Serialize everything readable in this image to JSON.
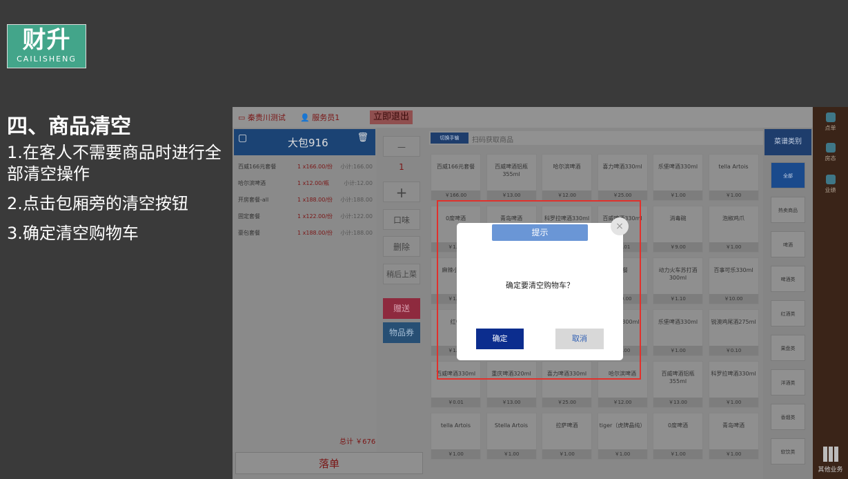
{
  "logo": {
    "main": "财升",
    "sub": "CAILISHENG"
  },
  "heading": "四、商品清空",
  "steps": [
    "1.在客人不需要商品时进行全部清空操作",
    "2.点击包厢旁的清空按钮",
    "3.确定清空购物车"
  ],
  "topbar": {
    "shop": "秦贵川测试",
    "staff": "服务员1",
    "exit": "立即退出"
  },
  "cart": {
    "room": "大包916",
    "rows": [
      {
        "name": "百威166元套餐",
        "qty": "1 x166.00/份",
        "subtotal": "小计:166.00"
      },
      {
        "name": "哈尔滨啤酒",
        "qty": "1 x12.00/瓶",
        "subtotal": "小计:12.00"
      },
      {
        "name": "开房套餐-all",
        "qty": "1 x188.00/份",
        "subtotal": "小计:188.00"
      },
      {
        "name": "固定套餐",
        "qty": "1 x122.00/份",
        "subtotal": "小计:122.00"
      },
      {
        "name": "豪包套餐",
        "qty": "1 x188.00/份",
        "subtotal": "小计:188.00"
      }
    ],
    "total": "总计 ￥676",
    "order": "落单"
  },
  "mid": {
    "minus": "—",
    "qty": "1",
    "plus": "+",
    "taste": "口味",
    "delete": "删除",
    "later": "稍后上菜",
    "gift": "赠送",
    "voucher": "物品券"
  },
  "search": {
    "scan": "切换手输",
    "placeholder": "扫码获取商品"
  },
  "products": [
    {
      "name": "百威166元套餐",
      "price": "￥166.00"
    },
    {
      "name": "百威啤酒铝瓶355ml",
      "price": "￥13.00"
    },
    {
      "name": "哈尔滨啤酒",
      "price": "￥12.00"
    },
    {
      "name": "喜力啤酒330ml",
      "price": "￥25.00"
    },
    {
      "name": "乐堡啤酒330ml",
      "price": "￥1.00"
    },
    {
      "name": "tella Artois",
      "price": "￥1.00"
    },
    {
      "name": "0度啤酒",
      "price": "￥1.00"
    },
    {
      "name": "青岛啤酒",
      "price": "￥1.00"
    },
    {
      "name": "科罗拉啤酒330ml",
      "price": "￥1.00"
    },
    {
      "name": "百威啤酒330ml",
      "price": "￥0.01"
    },
    {
      "name": "消毒碗",
      "price": "￥9.00"
    },
    {
      "name": "泡椒鸡爪",
      "price": "￥1.00"
    },
    {
      "name": "麻辣小龙虾",
      "price": "￥1.00"
    },
    {
      "name": "",
      "price": ""
    },
    {
      "name": "",
      "price": ""
    },
    {
      "name": "套餐",
      "price": "￥10.00"
    },
    {
      "name": "动力火车苏打酒300ml",
      "price": "￥1.10"
    },
    {
      "name": "百事可乐330ml",
      "price": "￥10.00"
    },
    {
      "name": "红牛",
      "price": "￥1.00"
    },
    {
      "name": "",
      "price": ""
    },
    {
      "name": "",
      "price": ""
    },
    {
      "name": "苏打酒300ml",
      "price": "￥1.00"
    },
    {
      "name": "乐堡啤酒330ml",
      "price": "￥1.00"
    },
    {
      "name": "锐澳鸡尾酒275ml",
      "price": "￥0.10"
    },
    {
      "name": "百威啤酒330ml",
      "price": "￥0.01"
    },
    {
      "name": "重庆啤酒320ml",
      "price": "￥13.00"
    },
    {
      "name": "喜力啤酒330ml",
      "price": "￥25.00"
    },
    {
      "name": "哈尔滨啤酒",
      "price": "￥12.00"
    },
    {
      "name": "百威啤酒铝瓶355ml",
      "price": "￥13.00"
    },
    {
      "name": "科罗拉啤酒330ml",
      "price": "￥1.00"
    },
    {
      "name": "tella Artois",
      "price": "￥1.00"
    },
    {
      "name": "Stella Artois",
      "price": "￥1.00"
    },
    {
      "name": "拉萨啤酒",
      "price": "￥1.00"
    },
    {
      "name": "tiger（虎牌晶纯）",
      "price": "￥1.00"
    },
    {
      "name": "0度啤酒",
      "price": "￥1.00"
    },
    {
      "name": "青岛啤酒",
      "price": "￥1.00"
    }
  ],
  "categories": {
    "header": "菜谱类别",
    "items": [
      "全部",
      "热卖商品",
      "啤酒",
      "啤酒类",
      "红酒类",
      "果盘类",
      "洋酒类",
      "香烟类",
      "软饮类"
    ]
  },
  "rightside": {
    "items": [
      "点单",
      "房态",
      "业绩"
    ],
    "other": "其他业务"
  },
  "modal": {
    "title": "提示",
    "close": "×",
    "message": "确定要清空购物车？",
    "ok": "确定",
    "cancel": "取消"
  }
}
